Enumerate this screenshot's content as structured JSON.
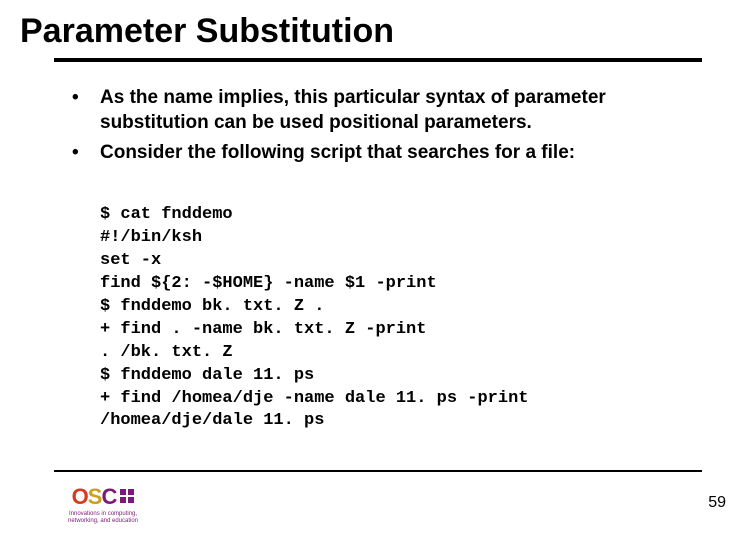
{
  "title": "Parameter Substitution",
  "bullets": [
    "As the name implies, this particular syntax of parameter substitution can be used positional parameters.",
    "Consider the following script that searches for a file:"
  ],
  "code_lines": [
    "$ cat fnddemo",
    "#!/bin/ksh",
    "set -x",
    "find ${2: -$HOME} -name $1 -print",
    "$ fnddemo bk. txt. Z .",
    "+ find . -name bk. txt. Z -print",
    ". /bk. txt. Z",
    "$ fnddemo dale 11. ps",
    "+ find /homea/dje -name dale 11. ps -print",
    "/homea/dje/dale 11. ps"
  ],
  "page_number": "59",
  "logo": {
    "letters": [
      "O",
      "S",
      "C"
    ],
    "tagline1": "Innovations in computing,",
    "tagline2": "networking, and education"
  }
}
